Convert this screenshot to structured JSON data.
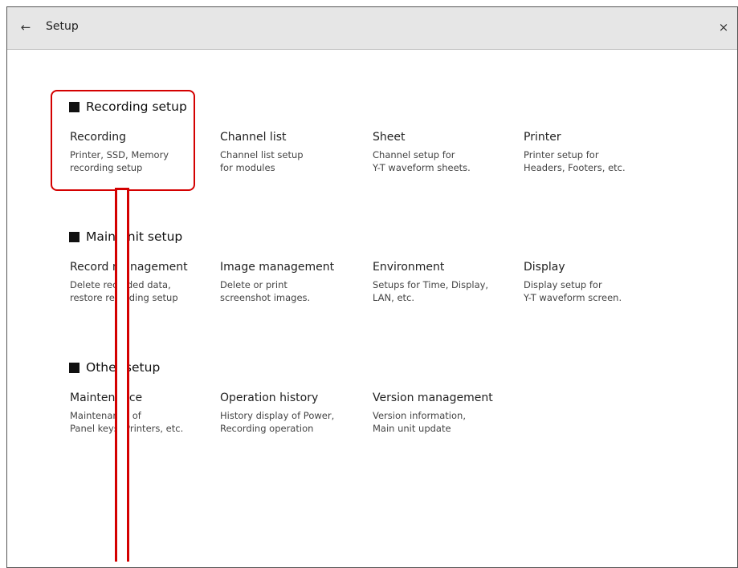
{
  "header": {
    "back_icon": "←",
    "title": "Setup",
    "close_icon": "×"
  },
  "sections": [
    {
      "title": "Recording setup",
      "items": [
        {
          "title": "Recording",
          "desc": "Printer, SSD, Memory\nrecording setup"
        },
        {
          "title": "Channel list",
          "desc": "Channel list setup\nfor modules"
        },
        {
          "title": "Sheet",
          "desc": "Channel setup for\nY-T waveform sheets."
        },
        {
          "title": "Printer",
          "desc": "Printer setup for\nHeaders, Footers, etc."
        }
      ]
    },
    {
      "title": "Main unit setup",
      "items": [
        {
          "title": "Record management",
          "desc": "Delete recorded data,\nrestore recording setup"
        },
        {
          "title": "Image management",
          "desc": "Delete or print\nscreenshot images."
        },
        {
          "title": "Environment",
          "desc": "Setups for Time, Display,\nLAN, etc."
        },
        {
          "title": "Display",
          "desc": "Display setup for\nY-T waveform screen."
        }
      ]
    },
    {
      "title": "Other setup",
      "items": [
        {
          "title": "Maintenance",
          "desc": "Maintenance of\nPanel keys, Printers, etc."
        },
        {
          "title": "Operation history",
          "desc": "History display of Power,\nRecording operation"
        },
        {
          "title": "Version management",
          "desc": "Version information,\nMain unit update"
        }
      ]
    }
  ],
  "colors": {
    "highlight": "#d40000",
    "titlebar": "#e6e6e6"
  }
}
